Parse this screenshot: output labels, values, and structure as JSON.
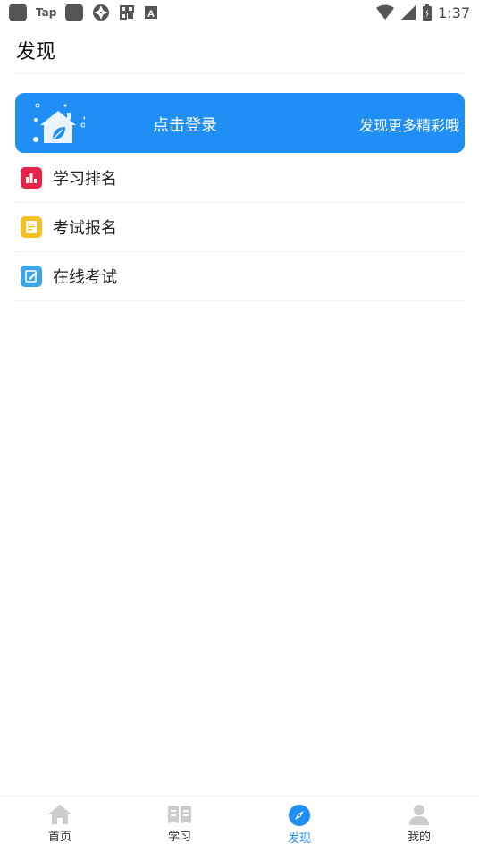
{
  "status_bar": {
    "app_icons": [
      "app-icon",
      "taptap-icon",
      "app-icon",
      "aperture-icon",
      "grid-icon",
      "a-icon"
    ],
    "tap_text": "Tap",
    "time": "1:37"
  },
  "header": {
    "title": "发现"
  },
  "banner": {
    "login_text": "点击登录",
    "tagline": "发现更多精彩哦",
    "color": "#1f8ff5"
  },
  "menu": {
    "items": [
      {
        "label": "学习排名",
        "icon": "bar-chart-icon",
        "color": "#e5244a"
      },
      {
        "label": "考试报名",
        "icon": "document-icon",
        "color": "#f5c023"
      },
      {
        "label": "在线考试",
        "icon": "edit-icon",
        "color": "#3ea6e6"
      }
    ]
  },
  "bottom_nav": {
    "items": [
      {
        "label": "首页",
        "icon": "home-icon"
      },
      {
        "label": "学习",
        "icon": "book-icon"
      },
      {
        "label": "发现",
        "icon": "compass-icon",
        "active": true
      },
      {
        "label": "我的",
        "icon": "user-icon"
      }
    ],
    "active_color": "#1f8ff5",
    "inactive_color": "#cccccc"
  }
}
